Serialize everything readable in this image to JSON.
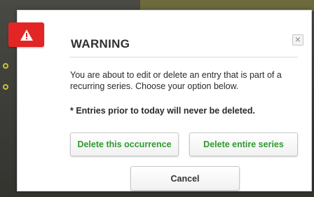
{
  "dialog": {
    "title": "WARNING",
    "message": "You are about to edit or delete an entry that is part of a recurring series. Choose your option below.",
    "note": "* Entries prior to today will never be deleted.",
    "buttons": {
      "delete_occurrence": "Delete this occurrence",
      "delete_series": "Delete entire series",
      "cancel": "Cancel"
    },
    "close_symbol": "×",
    "icon": "warning-triangle-icon"
  },
  "colors": {
    "warning_badge": "#e32525",
    "action_text": "#2f9a2f",
    "title_text": "#303030"
  }
}
